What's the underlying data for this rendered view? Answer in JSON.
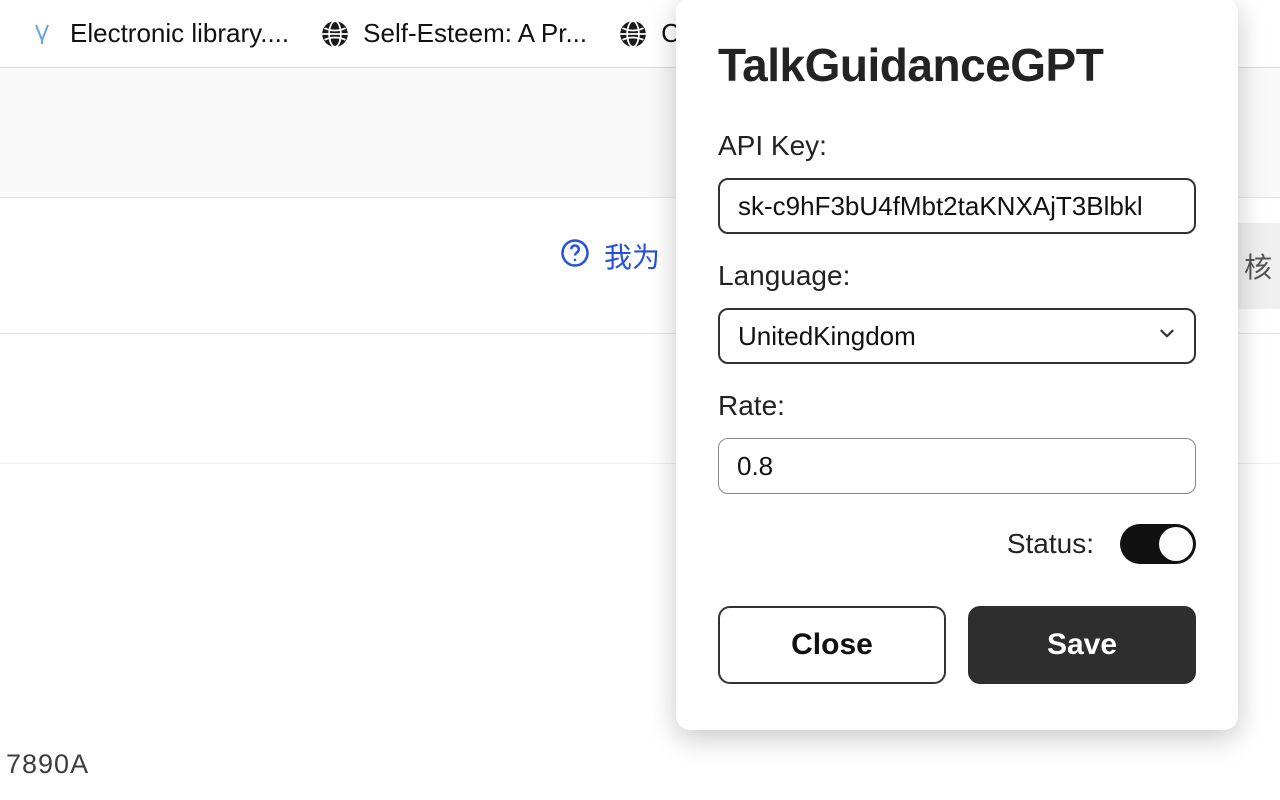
{
  "tabs": [
    {
      "title": "Electronic library....",
      "icon": "v"
    },
    {
      "title": "Self-Esteem: A Pr...",
      "icon": "globe"
    },
    {
      "title": "C",
      "icon": "globe"
    }
  ],
  "page": {
    "help_link_text": "我为",
    "right_pill_text": "核",
    "footer_code": "7890A"
  },
  "popup": {
    "title": "TalkGuidanceGPT",
    "api_key_label": "API Key:",
    "api_key_value": "sk-c9hF3bU4fMbt2taKNXAjT3Blbkl",
    "language_label": "Language:",
    "language_value": "UnitedKingdom",
    "rate_label": "Rate:",
    "rate_value": "0.8",
    "status_label": "Status:",
    "status_on": true,
    "close_label": "Close",
    "save_label": "Save"
  }
}
